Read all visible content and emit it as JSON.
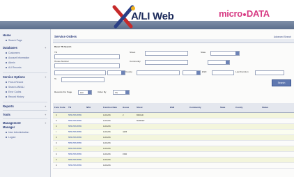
{
  "header": {
    "logo_text": "A/LI Web",
    "brand_text": "micro",
    "brand_text_2": "DATA"
  },
  "sidebar": {
    "items": [
      {
        "label": "Home",
        "kind": "head"
      },
      {
        "label": "Search Page",
        "kind": "sub"
      },
      {
        "label": "Databases",
        "kind": "head"
      },
      {
        "label": "Customers",
        "kind": "sub"
      },
      {
        "label": "Account Information",
        "kind": "sub"
      },
      {
        "label": "Admin",
        "kind": "sub"
      },
      {
        "label": "ALI Records",
        "kind": "sub"
      },
      {
        "label": "Service Options",
        "kind": "head"
      },
      {
        "label": "Find a Record",
        "kind": "sub"
      },
      {
        "label": "Search ANI/ALI",
        "kind": "sub"
      },
      {
        "label": "Error Codes",
        "kind": "sub"
      },
      {
        "label": "Record History",
        "kind": "sub"
      },
      {
        "label": "Reports",
        "kind": "head"
      },
      {
        "label": "Tools",
        "kind": "head"
      },
      {
        "label": "Management",
        "kind": "head"
      },
      {
        "label": "Manager",
        "kind": "head"
      },
      {
        "label": "User Administration",
        "kind": "sub"
      },
      {
        "label": "Logout",
        "kind": "sub"
      }
    ]
  },
  "main": {
    "title": "Service Orders",
    "advanced_link": "Advanced Search",
    "subtitle": "Basic TN Search",
    "labels": {
      "tn": "TN",
      "house_number": "House Number",
      "street": "Street",
      "community": "Community",
      "county": "County",
      "state": "State",
      "date_range": "Date / Function Date",
      "to": "To",
      "esn": "ESN",
      "last_function": "Last Function",
      "records_per_page": "Records Per Page",
      "order_by": "Order By"
    },
    "values": {
      "records_per_page": "100",
      "order_by": "TN"
    },
    "search_button": "Search",
    "table": {
      "headers": [
        "Func Code",
        "TN",
        "NPA",
        "Function Date",
        "House",
        "Street",
        "ESN",
        "Community",
        "State",
        "County",
        "Status"
      ],
      "rows": [
        [
          "C",
          "5555-555-5555",
          "",
          "11/01/06",
          "2",
          "BROAD",
          "",
          "",
          "",
          "",
          ""
        ],
        [
          "C",
          "5555-555-5555",
          "",
          "11/01/06",
          "",
          "MARKET",
          "",
          "",
          "",
          "",
          ""
        ],
        [
          "C",
          "5555-555-5555",
          "",
          "11/01/06",
          "",
          "",
          "",
          "",
          "",
          "",
          ""
        ],
        [
          "I",
          "5555-555-5555",
          "",
          "11/01/06",
          "4425",
          "",
          "",
          "",
          "",
          "",
          ""
        ],
        [
          "C",
          "5555-555-5555",
          "",
          "11/01/06",
          "",
          "",
          "",
          "",
          "",
          "",
          ""
        ],
        [
          "C",
          "5555-555-5555",
          "",
          "11/01/06",
          "",
          "",
          "",
          "",
          "",
          "",
          ""
        ],
        [
          "I",
          "5555-555-5555",
          "",
          "11/01/06",
          "",
          "",
          "",
          "",
          "",
          "",
          ""
        ],
        [
          "C",
          "5555-555-5555",
          "",
          "11/01/06",
          "1560",
          "",
          "",
          "",
          "",
          "",
          ""
        ],
        [
          "C",
          "5555-555-5555",
          "",
          "11/01/06",
          "",
          "",
          "",
          "",
          "",
          "",
          ""
        ],
        [
          "C",
          "5555-555-5555",
          "",
          "11/01/06",
          "",
          "",
          "",
          "",
          "",
          "",
          ""
        ]
      ]
    }
  },
  "colors": {
    "sidebar_bg": "#eef0f4",
    "accent": "#5f78b0",
    "brand_pink": "#d73a83",
    "navy": "#1b2a5a",
    "row_alt": "#f3f5dc"
  }
}
